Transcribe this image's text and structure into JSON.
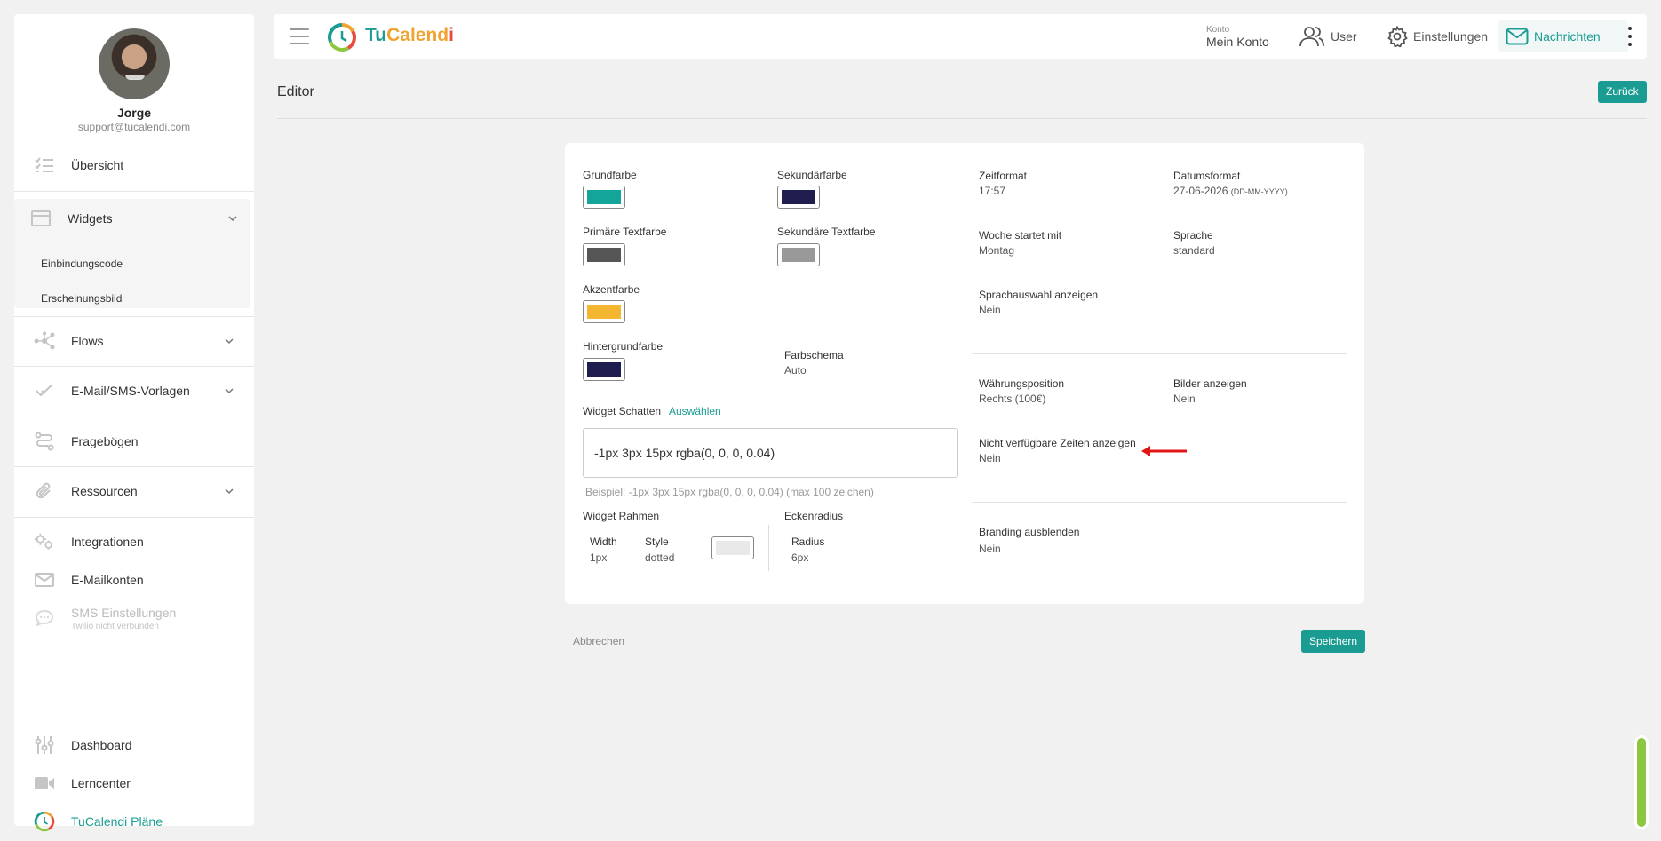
{
  "user": {
    "name": "Jorge",
    "email": "support@tucalendi.com"
  },
  "sidebar": {
    "overview": "Übersicht",
    "widgets": "Widgets",
    "widgets_sub": [
      "Einbindungscode",
      "Erscheinungsbild"
    ],
    "flows": "Flows",
    "templates": "E-Mail/SMS-Vorlagen",
    "questionnaires": "Fragebögen",
    "resources": "Ressourcen",
    "integrations": "Integrationen",
    "email_accounts": "E-Mailkonten",
    "sms_settings": "SMS Einstellungen",
    "sms_status": "Twilio nicht verbunden",
    "dashboard": "Dashboard",
    "learncenter": "Lerncenter",
    "plans": "TuCalendi Pläne"
  },
  "topbar": {
    "brand_part1": "Tu",
    "brand_part2": "Calend",
    "brand_part3": "i",
    "account_small": "Konto",
    "account_main": "Mein Konto",
    "user": "User",
    "settings": "Einstellungen",
    "messages": "Nachrichten"
  },
  "page": {
    "title": "Editor",
    "back": "Zurück"
  },
  "editor": {
    "primary_color_label": "Grundfarbe",
    "secondary_color_label": "Sekundärfarbe",
    "primary_text_label": "Primäre Textfarbe",
    "secondary_text_label": "Sekundäre Textfarbe",
    "accent_label": "Akzentfarbe",
    "background_label": "Hintergrundfarbe",
    "scheme_label": "Farbschema",
    "scheme_value": "Auto",
    "shadow_label": "Widget Schatten",
    "shadow_select": "Auswählen",
    "shadow_value": "-1px 3px 15px rgba(0, 0, 0, 0.04)",
    "shadow_hint": "Beispiel: -1px 3px 15px rgba(0, 0, 0, 0.04) (max 100 zeichen)",
    "border_label": "Widget Rahmen",
    "width_label": "Width",
    "width_value": "1px",
    "style_label": "Style",
    "style_value": "dotted",
    "radius_section": "Eckenradius",
    "radius_label": "Radius",
    "radius_value": "6px",
    "time_format_label": "Zeitformat",
    "time_format_value": "17:57",
    "date_format_label": "Datumsformat",
    "date_format_value": "27-06-2026",
    "date_format_hint": "(DD-MM-YYYY)",
    "week_start_label": "Woche startet mit",
    "week_start_value": "Montag",
    "language_label": "Sprache",
    "language_value": "standard",
    "lang_select_label": "Sprachauswahl anzeigen",
    "lang_select_value": "Nein",
    "currency_pos_label": "Währungsposition",
    "currency_pos_value": "Rechts (100€)",
    "images_label": "Bilder anzeigen",
    "images_value": "Nein",
    "unavailable_label": "Nicht verfügbare Zeiten anzeigen",
    "unavailable_value": "Nein",
    "branding_label": "Branding ausblenden",
    "branding_value": "Nein"
  },
  "colors": {
    "primary": "#14a59a",
    "secondary": "#201d4f",
    "primary_text": "#555555",
    "secondary_text": "#999999",
    "accent": "#f5b731",
    "background": "#201d4f",
    "brand_teal": "#1a9c92",
    "arrow_red": "#e31414"
  },
  "footer": {
    "cancel": "Abbrechen",
    "save": "Speichern"
  }
}
